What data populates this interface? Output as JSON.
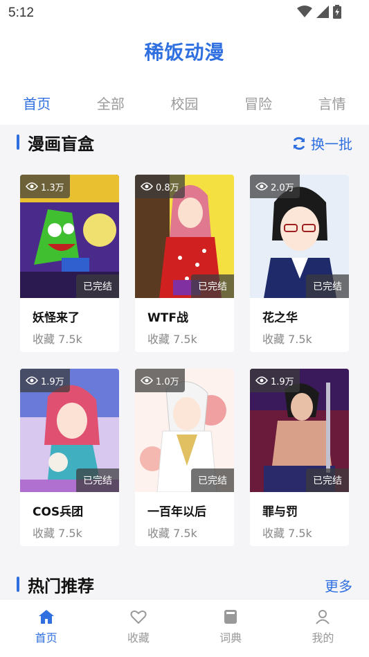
{
  "status_bar": {
    "time": "5:12"
  },
  "header": {
    "title": "稀饭动漫"
  },
  "tabs": [
    {
      "label": "首页",
      "active": true
    },
    {
      "label": "全部",
      "active": false
    },
    {
      "label": "校园",
      "active": false
    },
    {
      "label": "冒险",
      "active": false
    },
    {
      "label": "言情",
      "active": false
    }
  ],
  "blind_box": {
    "title": "漫画盲盒",
    "refresh_label": "换一批",
    "cards": [
      {
        "title": "妖怪来了",
        "views": "1.3万",
        "status": "已完结",
        "favorites": "收藏 7.5k"
      },
      {
        "title": "WTF战",
        "views": "0.8万",
        "status": "已完结",
        "favorites": "收藏 7.5k"
      },
      {
        "title": "花之华",
        "views": "2.0万",
        "status": "已完结",
        "favorites": "收藏 7.5k"
      },
      {
        "title": "COS兵团",
        "views": "1.9万",
        "status": "已完结",
        "favorites": "收藏 7.5k"
      },
      {
        "title": "一百年以后",
        "views": "1.0万",
        "status": "已完结",
        "favorites": "收藏 7.5k"
      },
      {
        "title": "罪与罚",
        "views": "1.9万",
        "status": "已完结",
        "favorites": "收藏 7.5k"
      }
    ]
  },
  "hot": {
    "title": "热门推荐",
    "more_label": "更多"
  },
  "bottom_nav": [
    {
      "label": "首页",
      "icon": "home-icon",
      "active": true
    },
    {
      "label": "收藏",
      "icon": "heart-icon",
      "active": false
    },
    {
      "label": "词典",
      "icon": "book-icon",
      "active": false
    },
    {
      "label": "我的",
      "icon": "user-icon",
      "active": false
    }
  ],
  "colors": {
    "accent": "#2f6fe0",
    "muted": "#999999",
    "background": "#f5f5f7"
  }
}
